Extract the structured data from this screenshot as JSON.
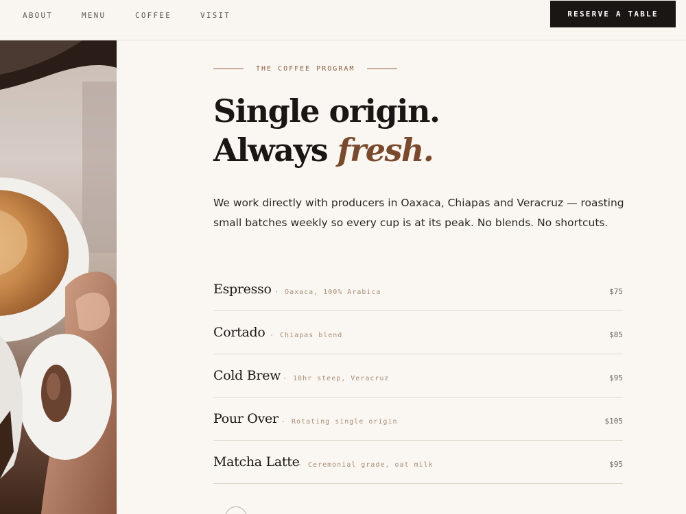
{
  "nav": {
    "links": [
      "ABOUT",
      "MENU",
      "COFFEE",
      "VISIT"
    ],
    "cta": "RESERVE A TABLE"
  },
  "section": {
    "eyebrow": "THE COFFEE PROGRAM",
    "headline_line1": "Single origin.",
    "headline_line2_plain": "Always ",
    "headline_line2_accent": "fresh.",
    "intro": "We work directly with producers in Oaxaca, Chiapas and Veracruz — roasting small batches weekly so every cup is at its peak. No blends. No shortcuts."
  },
  "menu": {
    "separator": "·",
    "items": [
      {
        "name": "Espresso",
        "desc": "Oaxaca, 100% Arabica",
        "price": "$75"
      },
      {
        "name": "Cortado",
        "desc": "Chiapas blend",
        "price": "$85"
      },
      {
        "name": "Cold Brew",
        "desc": "18hr steep, Veracruz",
        "price": "$95"
      },
      {
        "name": "Pour Over",
        "desc": "Rotating single origin",
        "price": "$105"
      },
      {
        "name": "Matcha Latte",
        "desc": "Ceremonial grade, oat milk",
        "price": "$95"
      }
    ]
  },
  "colors": {
    "background": "#faf7f2",
    "ink": "#1a1614",
    "accent": "#7a4a2e",
    "muted": "#a88e76"
  }
}
